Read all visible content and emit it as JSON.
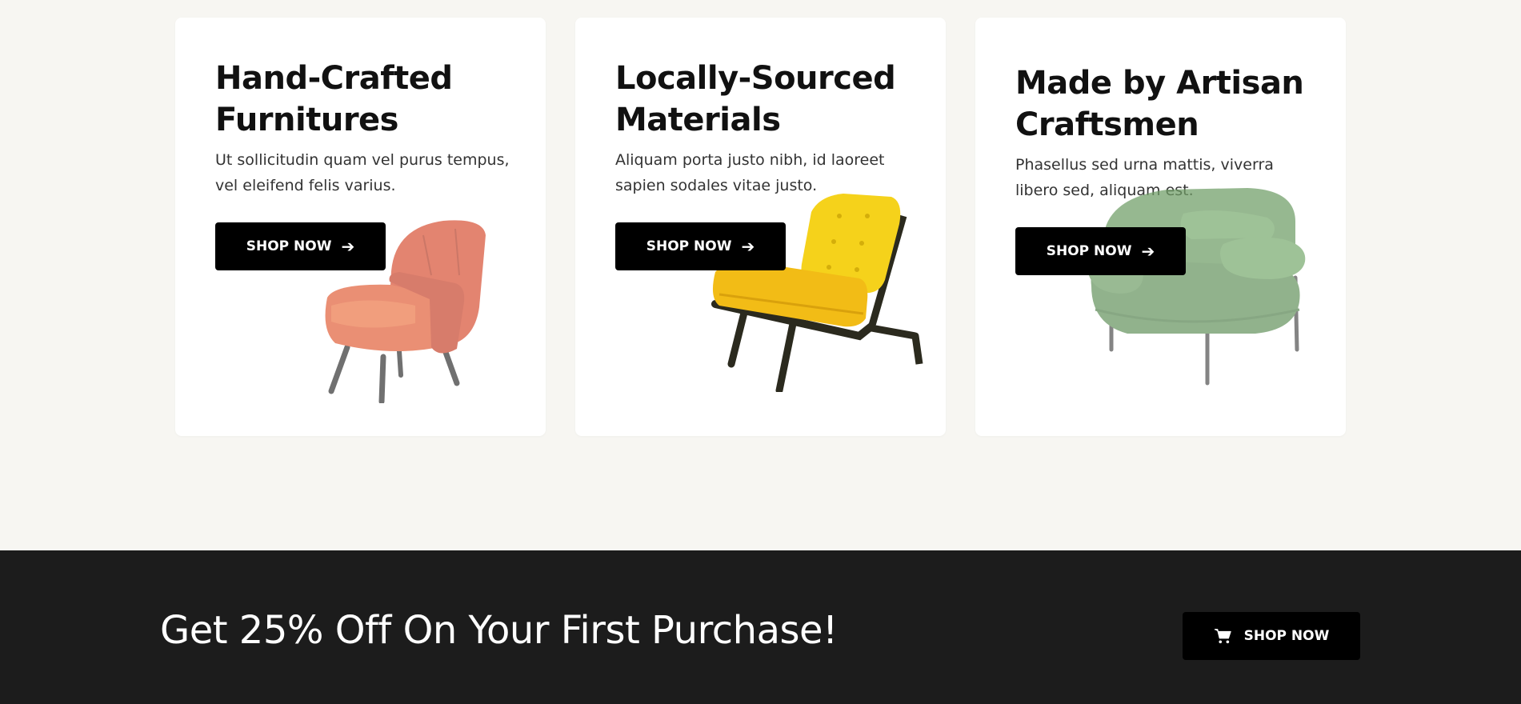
{
  "cards": [
    {
      "title_line1": "Hand-Crafted",
      "title_line2": "Furnitures",
      "description": "Ut sollicitudin quam vel purus tempus, vel eleifend felis varius.",
      "button_label": "SHOP NOW",
      "image": "red-armchair"
    },
    {
      "title_line1": "Locally-Sourced",
      "title_line2": "Materials",
      "description": "Aliquam porta justo nibh, id laoreet sapien sodales vitae justo.",
      "button_label": "SHOP NOW",
      "image": "yellow-lounge-chair"
    },
    {
      "title_line1": "Made by Artisan",
      "title_line2": "Craftsmen",
      "description": "Phasellus sed urna mattis, viverra libero sed, aliquam est.",
      "button_label": "SHOP NOW",
      "image": "green-armchair"
    }
  ],
  "banner": {
    "headline": "Get 25% Off On Your First Purchase!",
    "button_label": "SHOP NOW",
    "button_icon": "cart-icon"
  },
  "icons": {
    "button_arrow": "arrow-right-icon",
    "cart": "cart-icon"
  },
  "colors": {
    "page_background": "#f7f6f2",
    "card_background": "#ffffff",
    "button_background": "#000000",
    "banner_background": "#1c1c1c",
    "chair_red": "#e0623c",
    "chair_yellow": "#f5c518",
    "chair_green": "#6fa064"
  }
}
